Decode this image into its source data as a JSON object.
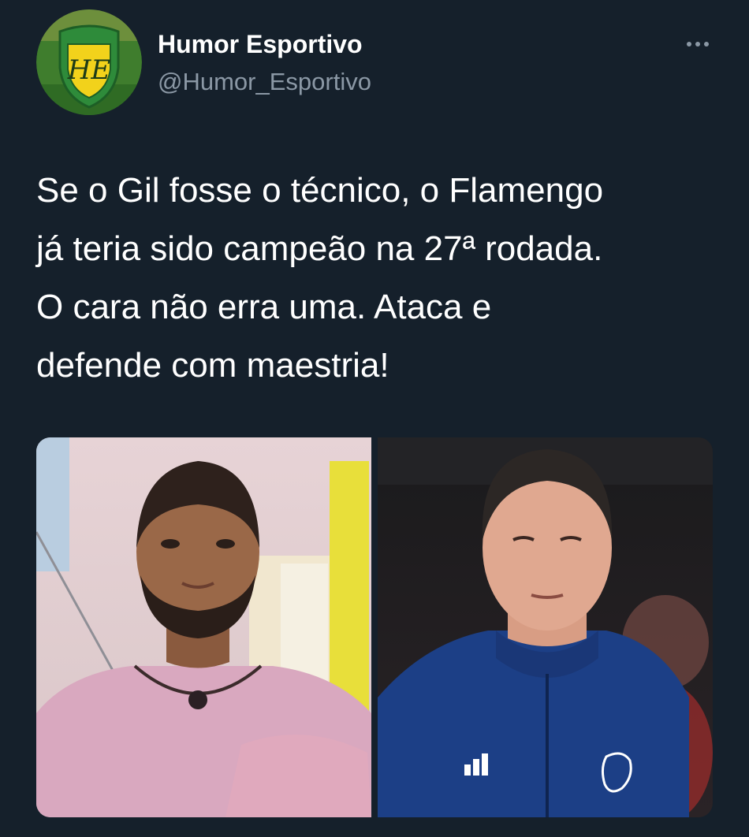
{
  "tweet": {
    "author": {
      "display_name": "Humor Esportivo",
      "handle": "@Humor_Esportivo",
      "avatar_monogram": "HE",
      "avatar_icon": "shield-crest-logo"
    },
    "more_icon": "more-horizontal-icon",
    "text_lines": [
      "Se o Gil fosse o técnico, o Flamengo",
      "já teria sido campeão na 27ª rodada.",
      "O cara não erra uma. Ataca e",
      "defende com maestria!"
    ],
    "media": [
      {
        "name": "photo-gil",
        "subject": "bearded man in pink shirt"
      },
      {
        "name": "photo-coach",
        "subject": "man in blue Flamengo jacket"
      }
    ]
  },
  "colors": {
    "background": "#15202b",
    "primary_text": "#ffffff",
    "secondary_text": "#8b98a5",
    "avatar_green": "#2e8b3a",
    "avatar_yellow": "#f2d21b"
  }
}
